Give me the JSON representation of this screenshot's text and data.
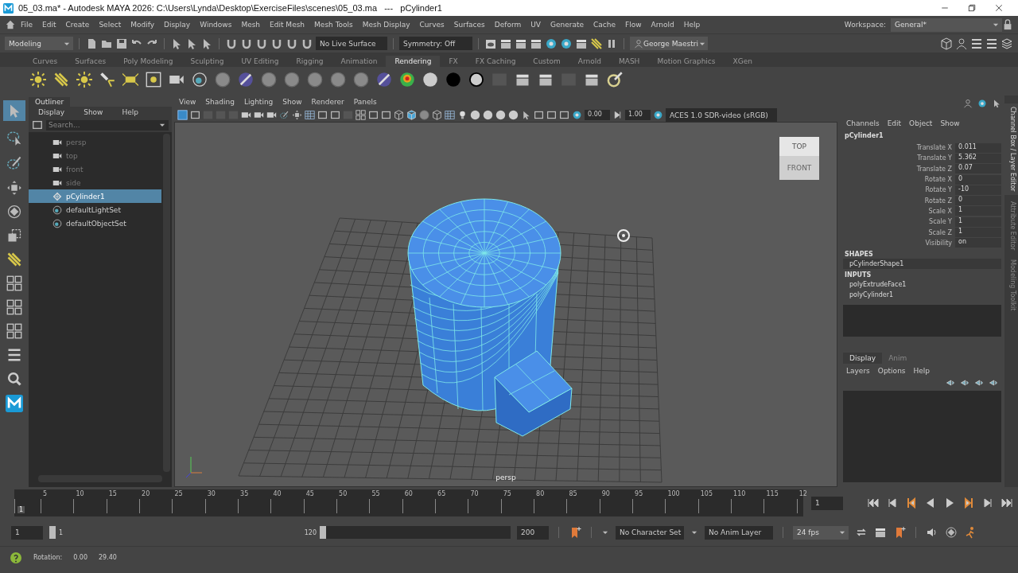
{
  "window": {
    "title": "05_03.ma* - Autodesk MAYA 2026: C:\\Users\\Lynda\\Desktop\\ExerciseFiles\\scenes\\05_03.ma   ---   pCylinder1"
  },
  "menu_bar": {
    "items": [
      "File",
      "Edit",
      "Create",
      "Select",
      "Modify",
      "Display",
      "Windows",
      "Mesh",
      "Edit Mesh",
      "Mesh Tools",
      "Mesh Display",
      "Curves",
      "Surfaces",
      "Deform",
      "UV",
      "Generate",
      "Cache",
      "Flow",
      "Arnold",
      "Help"
    ],
    "workspace_label": "Workspace:",
    "workspace": "General*"
  },
  "status_line": {
    "mode": "Modeling",
    "live_surface": "No Live Surface",
    "symmetry": "Symmetry: Off",
    "user": "George Maestri"
  },
  "shelf": {
    "tabs": [
      {
        "label": "Curves",
        "selected": false
      },
      {
        "label": "Surfaces",
        "selected": false
      },
      {
        "label": "Poly Modeling",
        "selected": false
      },
      {
        "label": "Sculpting",
        "selected": false
      },
      {
        "label": "UV Editing",
        "selected": false
      },
      {
        "label": "Rigging",
        "selected": false
      },
      {
        "label": "Animation",
        "selected": false
      },
      {
        "label": "Rendering",
        "selected": true
      },
      {
        "label": "FX",
        "selected": false
      },
      {
        "label": "FX Caching",
        "selected": false
      },
      {
        "label": "Custom",
        "selected": false
      },
      {
        "label": "Arnold",
        "selected": false
      },
      {
        "label": "MASH",
        "selected": false
      },
      {
        "label": "Motion Graphics",
        "selected": false
      },
      {
        "label": "XGen",
        "selected": false
      }
    ]
  },
  "outliner": {
    "title": "Outliner",
    "menus": [
      "Display",
      "Show",
      "Help"
    ],
    "search_placeholder": "Search...",
    "items": [
      {
        "label": "persp",
        "kind": "camera",
        "dimmed": true,
        "selected": false
      },
      {
        "label": "top",
        "kind": "camera",
        "dimmed": true,
        "selected": false
      },
      {
        "label": "front",
        "kind": "camera",
        "dimmed": true,
        "selected": false
      },
      {
        "label": "side",
        "kind": "camera",
        "dimmed": true,
        "selected": false
      },
      {
        "label": "pCylinder1",
        "kind": "mesh",
        "dimmed": false,
        "selected": true
      },
      {
        "label": "defaultLightSet",
        "kind": "set",
        "dimmed": false,
        "selected": false
      },
      {
        "label": "defaultObjectSet",
        "kind": "set",
        "dimmed": false,
        "selected": false
      }
    ]
  },
  "viewport": {
    "menus": [
      "View",
      "Shading",
      "Lighting",
      "Show",
      "Renderer",
      "Panels"
    ],
    "near": "0.00",
    "far": "1.00",
    "color_space": "ACES 1.0 SDR-video (sRGB)",
    "view_cube_top": "TOP",
    "view_cube_front": "FRONT",
    "camera": "persp"
  },
  "channel_box": {
    "menus": [
      "Channels",
      "Edit",
      "Object",
      "Show"
    ],
    "object": "pCylinder1",
    "attributes": [
      {
        "name": "Translate X",
        "value": "0.011"
      },
      {
        "name": "Translate Y",
        "value": "5.362"
      },
      {
        "name": "Translate Z",
        "value": "0.07"
      },
      {
        "name": "Rotate X",
        "value": "0"
      },
      {
        "name": "Rotate Y",
        "value": "-10"
      },
      {
        "name": "Rotate Z",
        "value": "0"
      },
      {
        "name": "Scale X",
        "value": "1"
      },
      {
        "name": "Scale Y",
        "value": "1"
      },
      {
        "name": "Scale Z",
        "value": "1"
      },
      {
        "name": "Visibility",
        "value": "on"
      }
    ],
    "shapes_heading": "SHAPES",
    "shapes": [
      "pCylinderShape1"
    ],
    "inputs_heading": "INPUTS",
    "inputs": [
      "polyExtrudeFace1",
      "polyCylinder1"
    ]
  },
  "layer_editor": {
    "tabs": [
      {
        "label": "Display",
        "selected": true
      },
      {
        "label": "Anim",
        "selected": false
      }
    ],
    "menus": [
      "Layers",
      "Options",
      "Help"
    ]
  },
  "side_tabs": [
    {
      "label": "Channel Box / Layer Editor",
      "selected": true
    },
    {
      "label": "Attribute Editor",
      "selected": false
    },
    {
      "label": "Modeling Toolkit",
      "selected": false
    }
  ],
  "time_slider": {
    "current_frame": "1",
    "level": 0,
    "ticks": [
      "5",
      "10",
      "15",
      "20",
      "25",
      "30",
      "35",
      "40",
      "45",
      "50",
      "55",
      "60",
      "65",
      "70",
      "75",
      "80",
      "85",
      "90",
      "95",
      "100",
      "105",
      "110",
      "115",
      "12"
    ],
    "frame_field": "1"
  },
  "range_slider": {
    "start": "1",
    "range_start": "1",
    "range_end": "120",
    "end": "200",
    "character_set": "No Character Set",
    "anim_layer": "No Anim Layer",
    "fps": "24 fps"
  },
  "help_line": {
    "label": "Rotation:",
    "values": [
      "0.00",
      "29.40"
    ]
  }
}
